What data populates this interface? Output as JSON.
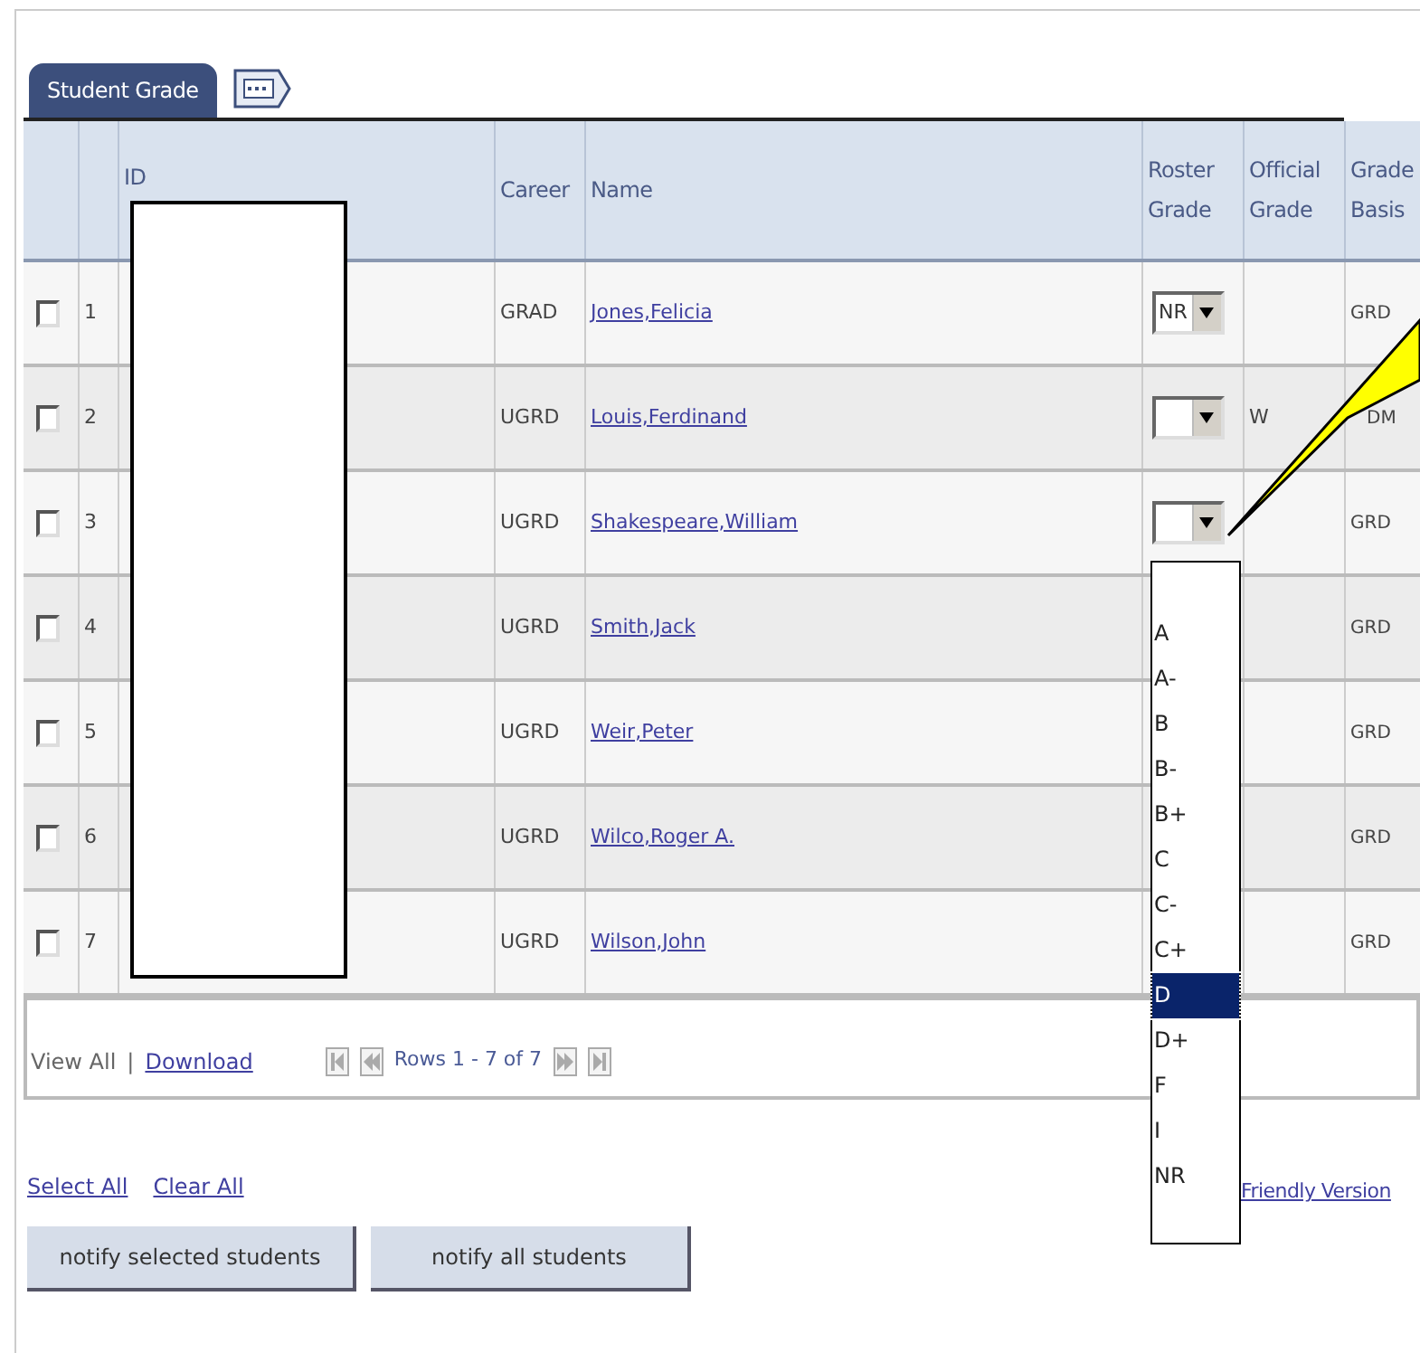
{
  "tabs": [
    {
      "label": "Student Grade",
      "selected": true
    }
  ],
  "table": {
    "columns": [
      "ID",
      "Career",
      "Name",
      "Roster Grade",
      "Official Grade",
      "Grade Basis"
    ],
    "rows": [
      {
        "number": "1",
        "checked": false,
        "career": "GRAD",
        "name": "Jones,Felicia",
        "roster_select": true,
        "roster_grade": "NR",
        "grade_basis": "GRD"
      },
      {
        "number": "2",
        "checked": false,
        "career": "UGRD",
        "name": "Louis,Ferdinand",
        "roster_select": true,
        "official_grade": "W",
        "grade_basis": "DM"
      },
      {
        "number": "3",
        "checked": false,
        "career": "UGRD",
        "name": "Shakespeare,William",
        "roster_select": true,
        "grade_basis": "GRD"
      },
      {
        "number": "4",
        "checked": false,
        "career": "UGRD",
        "name": "Smith,Jack",
        "grade_basis": "GRD"
      },
      {
        "number": "5",
        "checked": false,
        "career": "UGRD",
        "name": "Weir,Peter",
        "grade_basis": "GRD"
      },
      {
        "number": "6",
        "checked": false,
        "career": "UGRD",
        "name": "Wilco,Roger A.",
        "grade_basis": "GRD"
      },
      {
        "number": "7",
        "checked": false,
        "career": "UGRD",
        "name": "Wilson,John",
        "grade_basis": "GRD"
      }
    ]
  },
  "grade_dropdown": {
    "options": [
      {
        "label": "A",
        "selected": false
      },
      {
        "label": "A-",
        "selected": false
      },
      {
        "label": "B",
        "selected": false
      },
      {
        "label": "B-",
        "selected": false
      },
      {
        "label": "B+",
        "selected": false
      },
      {
        "label": "C",
        "selected": false
      },
      {
        "label": "C-",
        "selected": false
      },
      {
        "label": "C+",
        "selected": false
      },
      {
        "label": "D",
        "selected": true
      },
      {
        "label": "D+",
        "selected": false
      },
      {
        "label": "F",
        "selected": false
      },
      {
        "label": "I",
        "selected": false
      },
      {
        "label": "NR",
        "selected": false
      }
    ]
  },
  "footer": {
    "view_all": "View All",
    "separator": "|",
    "download": "Download",
    "rows_label": "Rows 1 - 7 of 7"
  },
  "links": [
    "Select All",
    "Clear All"
  ],
  "friendly_link": "Friendly Version",
  "buttons": [
    "notify selected students",
    "notify all students"
  ]
}
